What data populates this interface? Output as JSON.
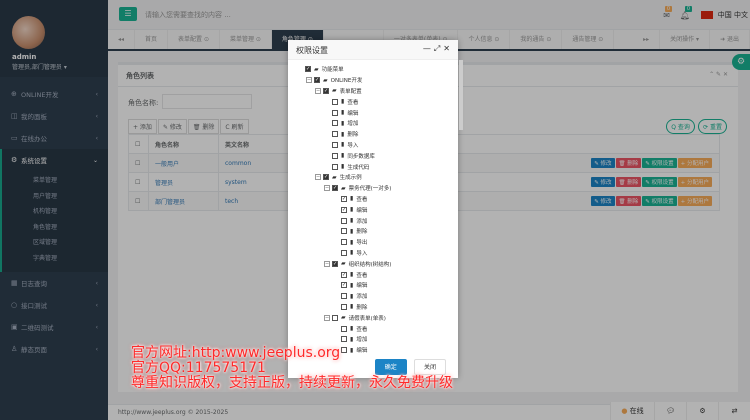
{
  "sidebar": {
    "username": "admin",
    "role": "管理员,部门管理员 ▾",
    "items": [
      {
        "icon": "⊕",
        "label": "ONLINE开发"
      },
      {
        "icon": "◫",
        "label": "我的面板"
      },
      {
        "icon": "▭",
        "label": "在线办公"
      },
      {
        "icon": "⚙",
        "label": "系统设置"
      }
    ],
    "subitems": [
      "菜单管理",
      "用户管理",
      "机构管理",
      "角色管理",
      "区域管理",
      "字典管理"
    ],
    "items2": [
      {
        "icon": "▦",
        "label": "日志查询"
      },
      {
        "icon": "○",
        "label": "接口测试"
      },
      {
        "icon": "▣",
        "label": "二维码测试"
      },
      {
        "icon": "♙",
        "label": "静态页面"
      }
    ]
  },
  "topbar": {
    "search_placeholder": "请输入您需要查找的内容 ...",
    "mail_count": "0",
    "bell_count": "0",
    "language": "中国 中文"
  },
  "tabs": [
    "首页",
    "表单配置 ⊙",
    "菜单管理 ⊙",
    "角色管理 ⊙",
    "",
    "一对多表单(单表) ⊙",
    "个人信息 ⊙",
    "我的通告 ⊙",
    "通告管理 ⊙"
  ],
  "tabbar": {
    "back": "◂◂",
    "forward": "▸▸",
    "close_ops": "关闭操作 ▾",
    "logout": "➜ 退出"
  },
  "panel": {
    "title": "角色列表",
    "search_label": "角色名称:",
    "add": "+ 添加",
    "edit": "✎ 修改",
    "delete": "🗑 删除",
    "refresh": "C 刷新",
    "query": "Q 查询",
    "reset": "⟳ 重置",
    "columns": [
      "角色名称",
      "英文名称"
    ],
    "rows": [
      {
        "name": "一般用户",
        "en": "common"
      },
      {
        "name": "管理员",
        "en": "system"
      },
      {
        "name": "部门管理员",
        "en": "tech"
      }
    ],
    "actions": {
      "edit": "✎ 修改",
      "delete": "🗑 删除",
      "perm": "✎ 权限设置",
      "assign": "+ 分配用户"
    }
  },
  "modal": {
    "title": "权限设置",
    "ok": "确定",
    "close": "关闭",
    "tree": [
      {
        "l": 0,
        "t": "folder",
        "c": "full",
        "label": "功能菜单"
      },
      {
        "l": 1,
        "t": "folder",
        "c": "full",
        "label": "ONLINE开发",
        "e": true
      },
      {
        "l": 2,
        "t": "folder",
        "c": "full",
        "label": "表单配置",
        "e": true
      },
      {
        "l": 3,
        "t": "file",
        "c": "",
        "label": "查看"
      },
      {
        "l": 3,
        "t": "file",
        "c": "",
        "label": "编辑"
      },
      {
        "l": 3,
        "t": "file",
        "c": "",
        "label": "增加"
      },
      {
        "l": 3,
        "t": "file",
        "c": "",
        "label": "删除"
      },
      {
        "l": 3,
        "t": "file",
        "c": "",
        "label": "导入"
      },
      {
        "l": 3,
        "t": "file",
        "c": "",
        "label": "同步数据库"
      },
      {
        "l": 3,
        "t": "file",
        "c": "",
        "label": "生成代码"
      },
      {
        "l": 2,
        "t": "folder",
        "c": "full",
        "label": "生成示例",
        "e": true
      },
      {
        "l": 3,
        "t": "folder",
        "c": "full",
        "label": "票务代理(一对多)",
        "e": true
      },
      {
        "l": 4,
        "t": "file",
        "c": "check",
        "label": "查看"
      },
      {
        "l": 4,
        "t": "file",
        "c": "check",
        "label": "编辑"
      },
      {
        "l": 4,
        "t": "file",
        "c": "",
        "label": "添加"
      },
      {
        "l": 4,
        "t": "file",
        "c": "",
        "label": "删除"
      },
      {
        "l": 4,
        "t": "file",
        "c": "",
        "label": "导出"
      },
      {
        "l": 4,
        "t": "file",
        "c": "",
        "label": "导入"
      },
      {
        "l": 3,
        "t": "folder",
        "c": "full",
        "label": "组织结构(树结构)",
        "e": true
      },
      {
        "l": 4,
        "t": "file",
        "c": "check",
        "label": "查看"
      },
      {
        "l": 4,
        "t": "file",
        "c": "check",
        "label": "编辑"
      },
      {
        "l": 4,
        "t": "file",
        "c": "",
        "label": "添加"
      },
      {
        "l": 4,
        "t": "file",
        "c": "",
        "label": "删除"
      },
      {
        "l": 3,
        "t": "folder",
        "c": "",
        "label": "请假表单(单表)",
        "e": true
      },
      {
        "l": 4,
        "t": "file",
        "c": "",
        "label": "查看"
      },
      {
        "l": 4,
        "t": "file",
        "c": "",
        "label": "增加"
      },
      {
        "l": 4,
        "t": "file",
        "c": "",
        "label": "编辑"
      }
    ]
  },
  "watermark": [
    "官方网址:http:www.jeeplus.org",
    "官方QQ:117575171",
    "尊重知识版权，支持正版，持续更新，永久免费升级"
  ],
  "footer": {
    "text": "http://www.jeeplus.org © 2015-2025"
  },
  "status": {
    "online": "在线"
  }
}
